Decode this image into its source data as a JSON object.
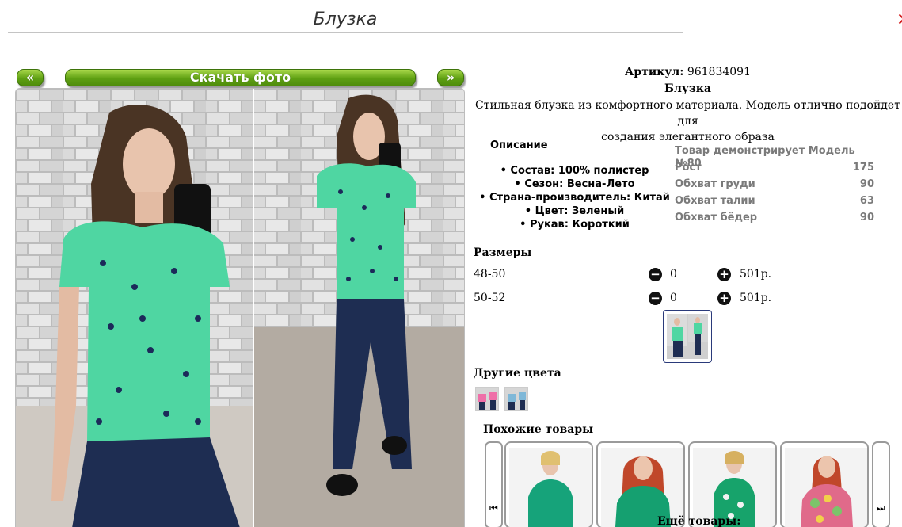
{
  "page": {
    "title": "Блузка"
  },
  "gallery": {
    "prev_label": "«",
    "next_label": "»",
    "download_label": "Скачать фото"
  },
  "product": {
    "article_label": "Артикул:",
    "article_value": "961834091",
    "name": "Блузка",
    "description_line1": "Стильная блузка из комфортного материала. Модель отлично подойдет для",
    "description_line2": "создания элегантного образа"
  },
  "details": {
    "heading": "Описание",
    "items": [
      "Состав: 100% полистер",
      "Сезон: Весна-Лето",
      "Страна-производитель: Китай",
      "Цвет: Зеленый",
      "Рукав: Короткий"
    ]
  },
  "model": {
    "heading": "Товар демонстрирует Модель №80",
    "rows": [
      {
        "label": "Рост",
        "value": "175"
      },
      {
        "label": "Обхват груди",
        "value": "90"
      },
      {
        "label": "Обхват талии",
        "value": "63"
      },
      {
        "label": "Обхват бёдер",
        "value": "90"
      }
    ]
  },
  "sizes": {
    "heading": "Размеры",
    "rows": [
      {
        "size": "48-50",
        "quantity": "0",
        "price": "501р."
      },
      {
        "size": "50-52",
        "quantity": "0",
        "price": "501р."
      }
    ],
    "minus_icon": "−",
    "plus_icon": "+"
  },
  "other_colors": {
    "heading": "Другие цвета"
  },
  "similar": {
    "heading": "Похожие товары",
    "prev_icon": "⏮",
    "next_icon": "⏭",
    "more_label": "Ещё товары:"
  },
  "colors": {
    "button_green": "#5fa013",
    "blouse_green": "#4fd6a2",
    "jeans_blue": "#1e2d52",
    "brick_grey": "#c9c9c9"
  }
}
